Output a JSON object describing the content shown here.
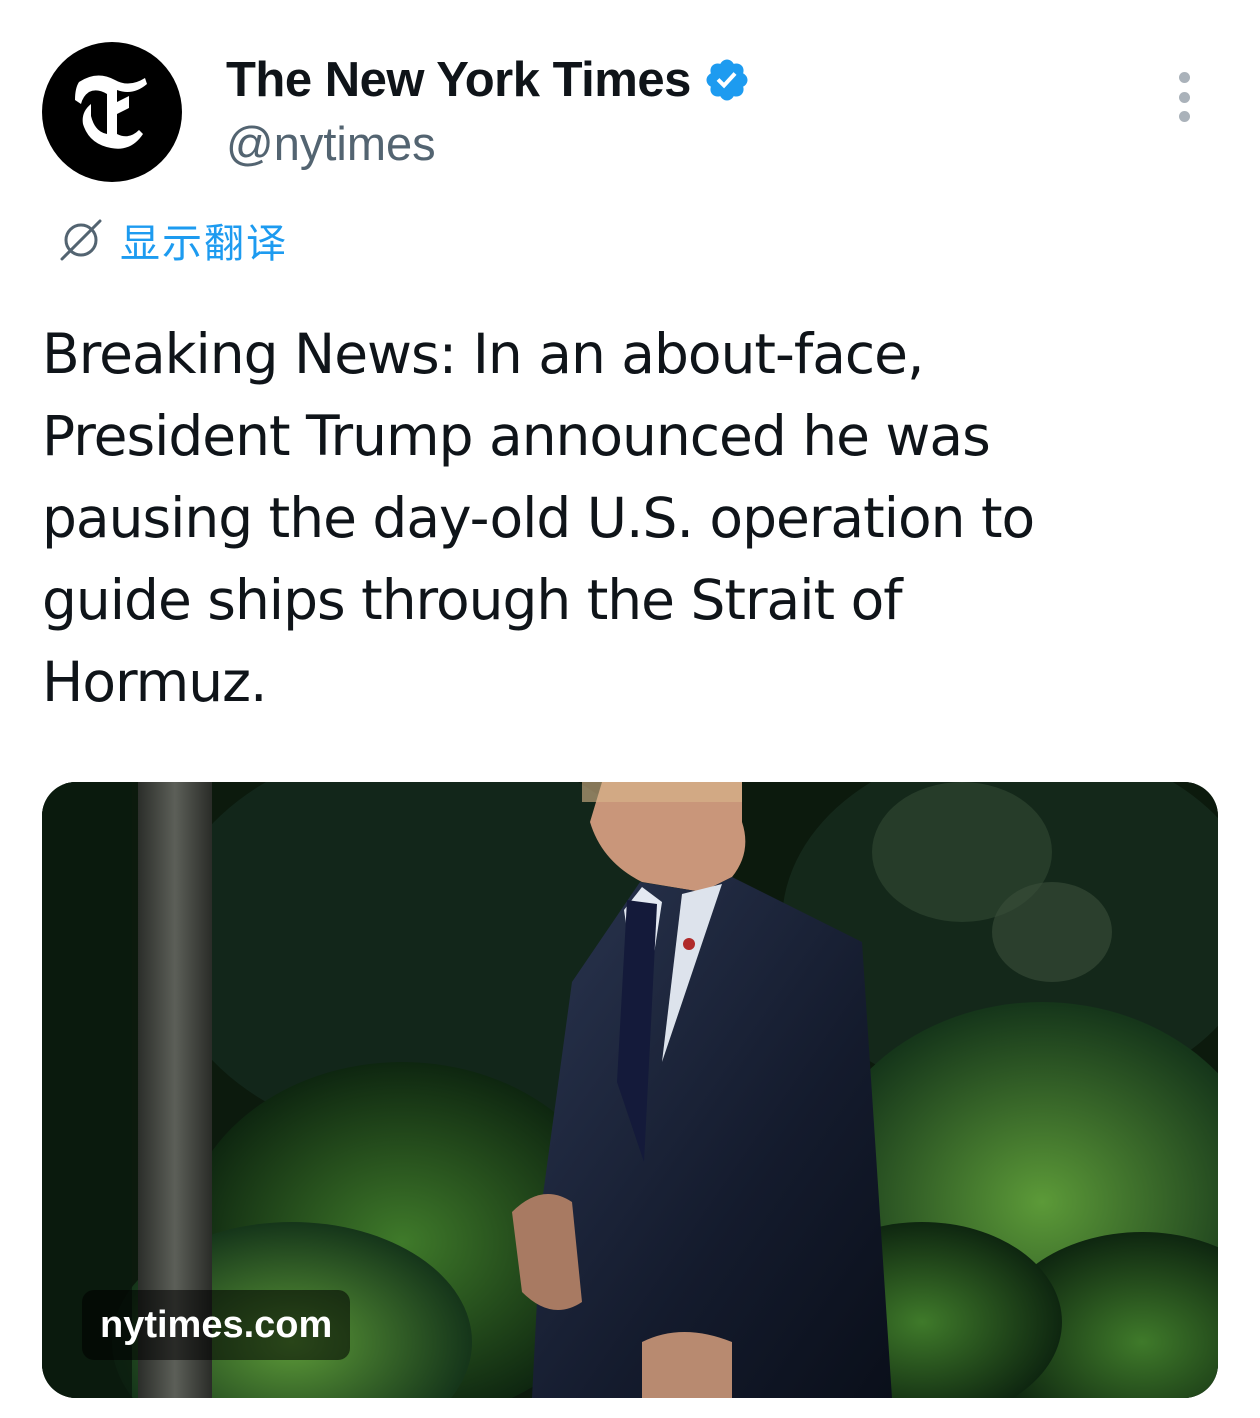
{
  "author": {
    "display_name": "The New York Times",
    "handle": "@nytimes",
    "verified": true,
    "avatar_icon": "nyt-t-logo-icon"
  },
  "translate": {
    "label": "显示翻译",
    "icon": "translate-globe-icon"
  },
  "tweet": {
    "text": "Breaking News: In an about-face, President Trump announced he was pausing the day-old U.S. operation to guide ships through the Strait of Hormuz."
  },
  "media": {
    "domain": "nytimes.com"
  },
  "colors": {
    "accent": "#1d9bf0",
    "verified": "#1d9bf0",
    "text": "#0f1419",
    "secondary": "#536471"
  }
}
